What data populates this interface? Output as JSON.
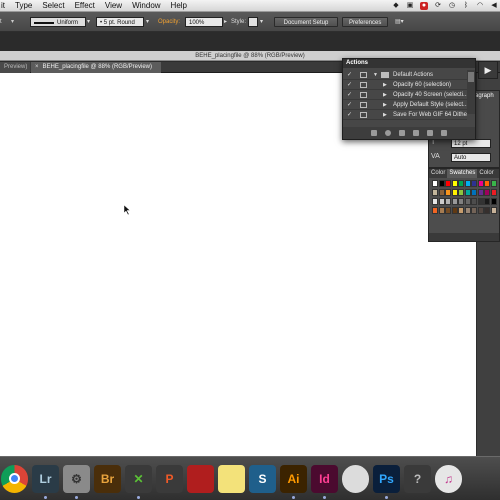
{
  "menubar": {
    "items": [
      "it",
      "Type",
      "Select",
      "Effect",
      "View",
      "Window",
      "Help"
    ]
  },
  "controlbar": {
    "fill_label": "t",
    "stroke_profile": "Uniform",
    "brush": "5 pt. Round",
    "opacity_label": "Opacity:",
    "opacity_value": "100%",
    "style_label": "Style:",
    "document_setup": "Document Setup",
    "preferences": "Preferences"
  },
  "document": {
    "title": "BEHE_placingfile @ 88% (RGB/Preview)",
    "tabs": [
      {
        "label": "Preview)"
      },
      {
        "label": "BEHE_placingfile @ 88% (RGB/Preview)"
      }
    ]
  },
  "actions_panel": {
    "title": "Actions",
    "rows": [
      {
        "label": "Default Actions",
        "type": "folder"
      },
      {
        "label": "Opacity 60 (selection)",
        "type": "action"
      },
      {
        "label": "Opacity 40 Screen (selecti...",
        "type": "action"
      },
      {
        "label": "Apply Default Style (select...",
        "type": "action"
      },
      {
        "label": "Save For Web GIF 64 Dithe...",
        "type": "action"
      }
    ]
  },
  "character_panel": {
    "tab_label": "ragraph",
    "font_size": "12 pt",
    "leading": "Auto"
  },
  "swatches_panel": {
    "tabs": [
      "Color",
      "Swatches",
      "Color"
    ],
    "active_tab": "Swatches",
    "colors": [
      "#ffffff",
      "#000000",
      "#ff0000",
      "#ffff00",
      "#00a651",
      "#00aeef",
      "#2e3192",
      "#ec008c",
      "#ff6600",
      "#39b54a",
      "#c2b59b",
      "#8c6239",
      "#f7941d",
      "#fff200",
      "#8dc63f",
      "#00a99d",
      "#0072bc",
      "#662d91",
      "#9e005d",
      "#ed1c24",
      "#e6e6e6",
      "#cccccc",
      "#b3b3b3",
      "#999999",
      "#808080",
      "#666666",
      "#4d4d4d",
      "#333333",
      "#1a1a1a",
      "#000000",
      "#f26522",
      "#a67c52",
      "#754c24",
      "#603913",
      "#c69c6d",
      "#998675",
      "#736357",
      "#534741",
      "#362f2d",
      "#c7b299"
    ]
  },
  "dock": {
    "apps": [
      {
        "name": "chrome-icon",
        "label": "",
        "bg": "#ffffff",
        "fg": "#db4437"
      },
      {
        "name": "lightroom-icon",
        "label": "Lr",
        "bg": "#2a3b47",
        "fg": "#b0cfe0"
      },
      {
        "name": "settings-icon",
        "label": "⚙",
        "bg": "#8a8a8a",
        "fg": "#333333"
      },
      {
        "name": "bridge-icon",
        "label": "Br",
        "bg": "#4a2e0a",
        "fg": "#e8a33d"
      },
      {
        "name": "x-icon",
        "label": "✕",
        "bg": "#3a3a3a",
        "fg": "#5bc236"
      },
      {
        "name": "p-icon",
        "label": "P",
        "bg": "#3a3a3a",
        "fg": "#f05a28"
      },
      {
        "name": "photo-booth-icon",
        "label": "",
        "bg": "#b01e1e",
        "fg": "#ffffff"
      },
      {
        "name": "stickies-icon",
        "label": "",
        "bg": "#f3e27a",
        "fg": "#555555"
      },
      {
        "name": "s-icon",
        "label": "S",
        "bg": "#1f5f8b",
        "fg": "#ffffff"
      },
      {
        "name": "illustrator-icon",
        "label": "Ai",
        "bg": "#3b2300",
        "fg": "#ff9a00"
      },
      {
        "name": "indesign-icon",
        "label": "Id",
        "bg": "#4b0a2f",
        "fg": "#ff3f94"
      },
      {
        "name": "clock-icon",
        "label": "",
        "bg": "#dcdcdc",
        "fg": "#333333"
      },
      {
        "name": "photoshop-icon",
        "label": "Ps",
        "bg": "#0a1f3b",
        "fg": "#31a8ff"
      },
      {
        "name": "help-icon",
        "label": "?",
        "bg": "#3a3a3a",
        "fg": "#bbbbbb"
      },
      {
        "name": "itunes-icon",
        "label": "♫",
        "bg": "#e6e6e6",
        "fg": "#c23a8e"
      }
    ]
  }
}
